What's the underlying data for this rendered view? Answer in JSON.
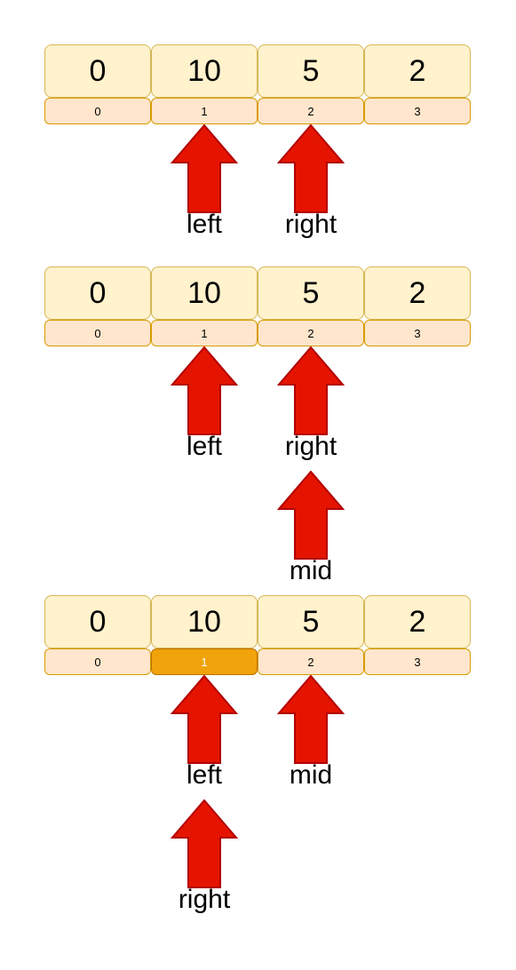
{
  "colors": {
    "value_fill": "#fff2cc",
    "value_border": "#d6b656",
    "index_fill": "#ffe6cc",
    "index_border": "#d79b00",
    "index_highlight_fill": "#f0a30a",
    "index_highlight_text": "#ffffff",
    "arrow_fill": "#e51400",
    "arrow_stroke": "#b20000"
  },
  "panels": [
    {
      "values": [
        "0",
        "10",
        "5",
        "2"
      ],
      "indices": [
        "0",
        "1",
        "2",
        "3"
      ],
      "highlighted_index": null,
      "pointers": [
        {
          "label": "left",
          "index": 1,
          "level": 0
        },
        {
          "label": "right",
          "index": 2,
          "level": 0
        }
      ]
    },
    {
      "values": [
        "0",
        "10",
        "5",
        "2"
      ],
      "indices": [
        "0",
        "1",
        "2",
        "3"
      ],
      "highlighted_index": null,
      "pointers": [
        {
          "label": "left",
          "index": 1,
          "level": 0
        },
        {
          "label": "right",
          "index": 2,
          "level": 0
        },
        {
          "label": "mid",
          "index": 2,
          "level": 1
        }
      ]
    },
    {
      "values": [
        "0",
        "10",
        "5",
        "2"
      ],
      "indices": [
        "0",
        "1",
        "2",
        "3"
      ],
      "highlighted_index": 1,
      "pointers": [
        {
          "label": "left",
          "index": 1,
          "level": 0
        },
        {
          "label": "mid",
          "index": 2,
          "level": 0
        },
        {
          "label": "right",
          "index": 1,
          "level": 1
        }
      ]
    }
  ]
}
